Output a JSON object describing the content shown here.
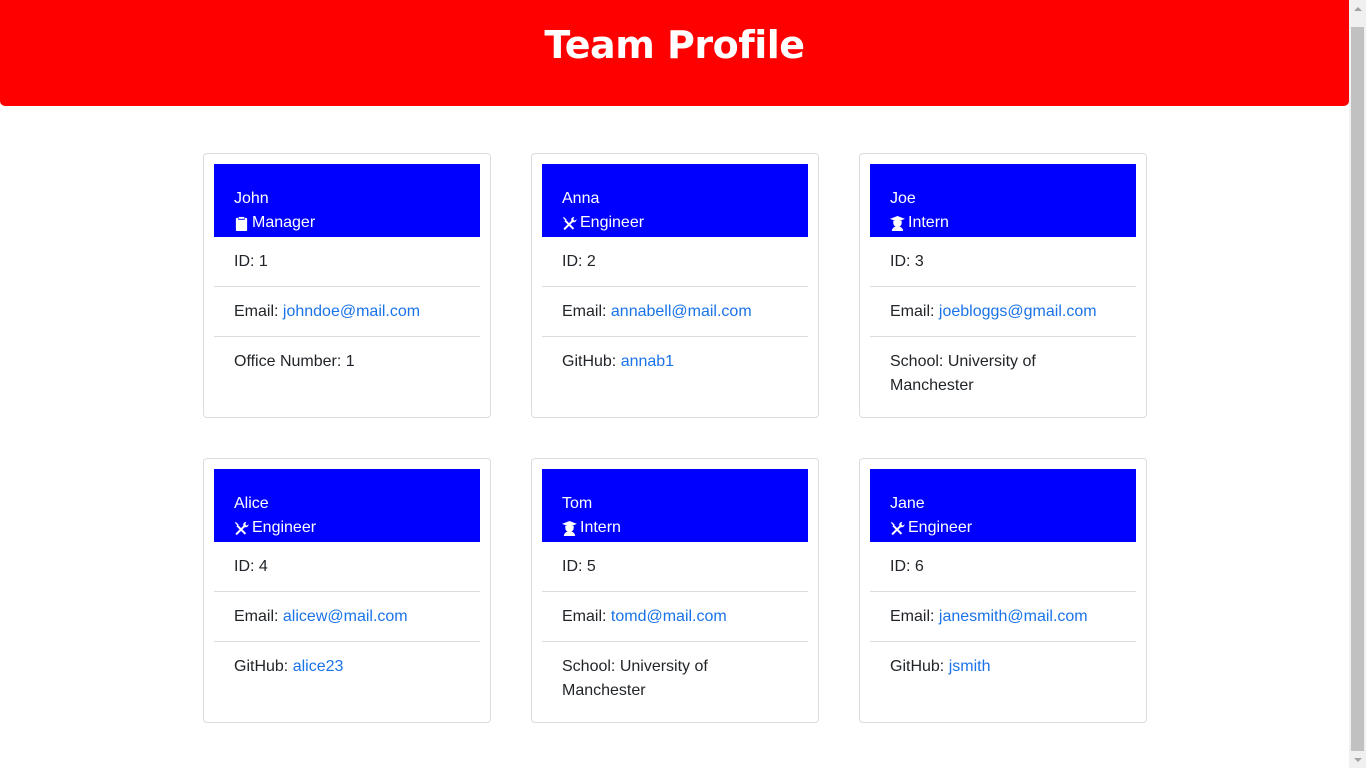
{
  "header": {
    "title": "Team Profile"
  },
  "cards": [
    {
      "name": "John",
      "role": "Manager",
      "role_icon": "clipboard-icon",
      "id_label": "ID: ",
      "id": "1",
      "email_label": "Email: ",
      "email": "johndoe@mail.com",
      "extra_label": "Office Number: ",
      "extra_value": "1"
    },
    {
      "name": "Anna",
      "role": "Engineer",
      "role_icon": "tools-icon",
      "id_label": "ID: ",
      "id": "2",
      "email_label": "Email: ",
      "email": "annabell@mail.com",
      "extra_label": "GitHub: ",
      "extra_value": "annab1"
    },
    {
      "name": "Joe",
      "role": "Intern",
      "role_icon": "graduate-icon",
      "id_label": "ID: ",
      "id": "3",
      "email_label": "Email: ",
      "email": "joebloggs@gmail.com",
      "extra_label": "School: ",
      "extra_value": "University of Manchester"
    },
    {
      "name": "Alice",
      "role": "Engineer",
      "role_icon": "tools-icon",
      "id_label": "ID: ",
      "id": "4",
      "email_label": "Email: ",
      "email": "alicew@mail.com",
      "extra_label": "GitHub: ",
      "extra_value": "alice23"
    },
    {
      "name": "Tom",
      "role": "Intern",
      "role_icon": "graduate-icon",
      "id_label": "ID: ",
      "id": "5",
      "email_label": "Email: ",
      "email": "tomd@mail.com",
      "extra_label": "School: ",
      "extra_value": "University of Manchester"
    },
    {
      "name": "Jane",
      "role": "Engineer",
      "role_icon": "tools-icon",
      "id_label": "ID: ",
      "id": "6",
      "email_label": "Email: ",
      "email": "janesmith@mail.com",
      "extra_label": "GitHub: ",
      "extra_value": "jsmith"
    }
  ],
  "colors": {
    "header_bg": "#ff0000",
    "card_header_bg": "#0000ff",
    "link": "#1a73e8"
  }
}
